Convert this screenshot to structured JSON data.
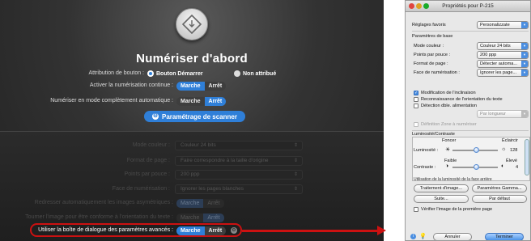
{
  "left_panel": {
    "title": "Numériser d'abord",
    "attribution_label": "Attribution de bouton :",
    "attr_option1": "Bouton Démarrer",
    "attr_option2": "Non attribué",
    "continuous_label": "Activer la numérisation continue :",
    "auto_label": "Numériser en mode complètement automatique :",
    "marche": "Marche",
    "arret": "Arrêt",
    "scanner_button": "Paramétrage de scanner",
    "disabled": {
      "mode_couleur_label": "Mode couleur :",
      "mode_couleur_value": "Couleur 24 bits",
      "format_label": "Format de page :",
      "format_value": "Faire correspondre à la taille d'origine",
      "ppp_label": "Points par pouce :",
      "ppp_value": "200 ppp",
      "face_label": "Face de numérisation :",
      "face_value": "Ignorer les pages blanches",
      "redresser_label": "Redresser automatiquement les images asymétriques :",
      "tourner_label": "Tourner l'image pour être conforme à l'orientation du texte :"
    },
    "highlight_label": "Utiliser la boîte de dialogue des paramètres avancés :"
  },
  "dialog": {
    "title": "Propriétés pour P-215",
    "favoris_label": "Réglages favoris",
    "favoris_value": "Personalizzate",
    "base_header": "Paramètres de base",
    "mode_label": "Mode couleur :",
    "mode_value": "Couleur 24 bits",
    "ppp_label": "Points par pouce :",
    "ppp_value": "200 ppp",
    "format_label": "Format de page :",
    "format_value": "Détecter automa...",
    "face_label": "Face de numérisation :",
    "face_value": "Ignorer les page...",
    "cb_inclinaison": "Modification de l'inclinaison",
    "cb_orientation": "Reconnaissance de l'orientation du texte",
    "cb_alimentation": "Détection dble. alimentation",
    "longueur_value": "Par longueur",
    "cb_zone": "Définition Zone à numériser",
    "lum_header": "Luminosité/Contraste",
    "foncer": "Foncer",
    "eclaircir": "Éclaircir",
    "luminosite_label": "Luminosité :",
    "luminosite_value": "128",
    "faible": "Faible",
    "eleve": "Élevé",
    "contraste_label": "Contraste :",
    "contraste_value": "4",
    "cut_text": "Utilisation de la luminosité de la face arrière",
    "btn_traitement": "Traitement d'image...",
    "btn_gamma": "Paramètres Gamma...",
    "btn_suite": "Suite...",
    "btn_defaut": "Par défaut",
    "cb_verifier": "Vérifier l'image de la première page",
    "btn_annuler": "Annuler",
    "btn_terminer": "Terminer"
  },
  "colors": {
    "accent_blue": "#2f7fd8",
    "highlight_red": "#cc1111",
    "dark_bg": "#222222"
  }
}
